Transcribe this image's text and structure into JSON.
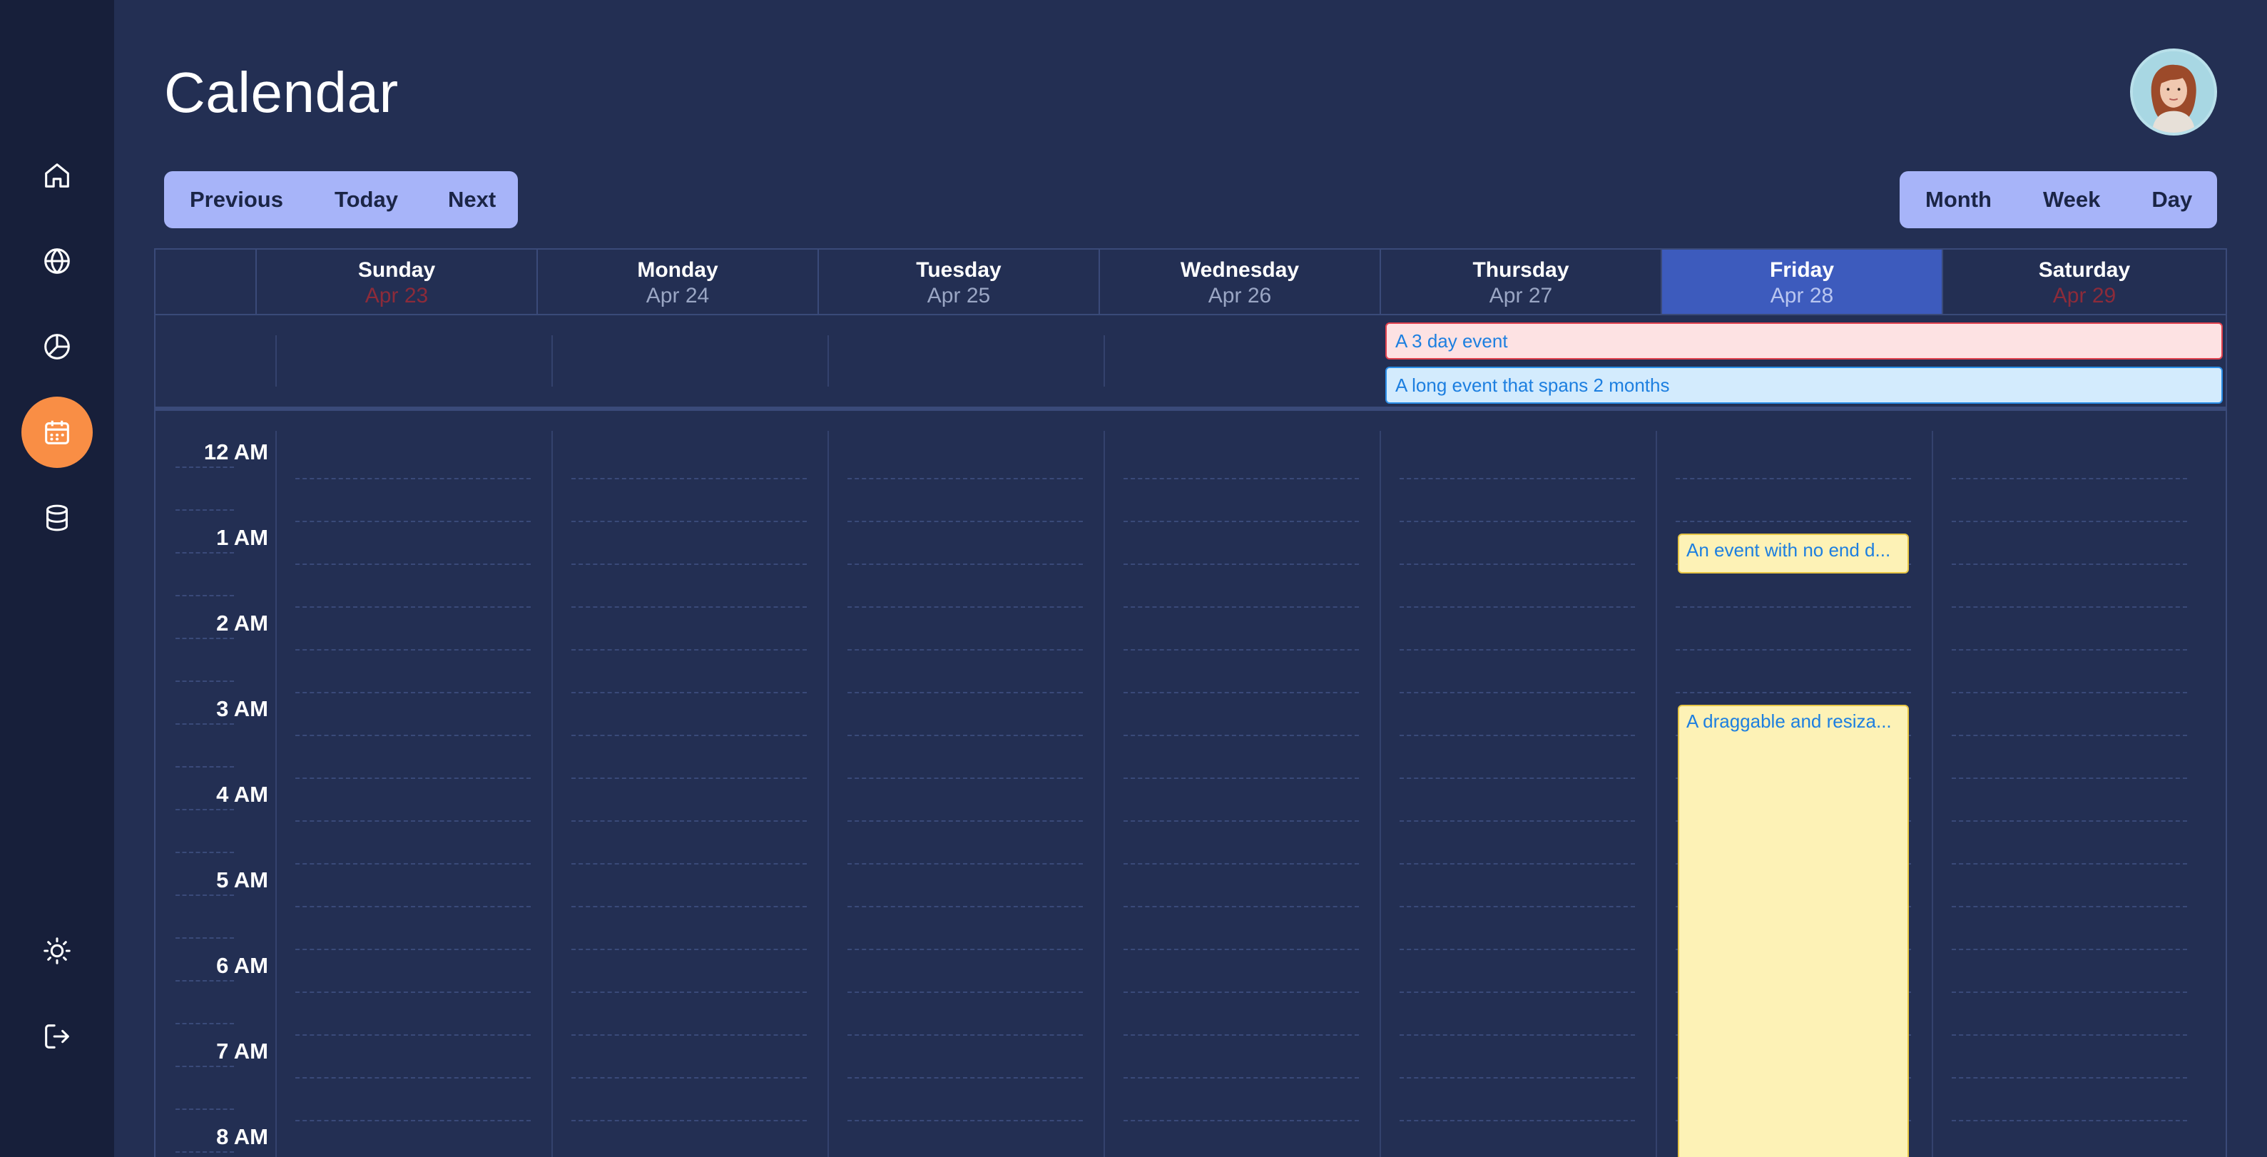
{
  "sidebar": {
    "items": [
      {
        "icon": "home-icon",
        "active": false
      },
      {
        "icon": "globe-icon",
        "active": false
      },
      {
        "icon": "pie-chart-icon",
        "active": false
      },
      {
        "icon": "calendar-icon",
        "active": true
      },
      {
        "icon": "database-icon",
        "active": false
      }
    ],
    "bottom_items": [
      {
        "icon": "sun-icon"
      },
      {
        "icon": "logout-icon"
      }
    ]
  },
  "header": {
    "title": "Calendar"
  },
  "nav_buttons": {
    "previous": "Previous",
    "today": "Today",
    "next": "Next"
  },
  "view_buttons": {
    "month": "Month",
    "week": "Week",
    "day": "Day"
  },
  "days": [
    {
      "name": "Sunday",
      "date": "Apr 23",
      "weekend": true,
      "today": false
    },
    {
      "name": "Monday",
      "date": "Apr 24",
      "weekend": false,
      "today": false
    },
    {
      "name": "Tuesday",
      "date": "Apr 25",
      "weekend": false,
      "today": false
    },
    {
      "name": "Wednesday",
      "date": "Apr 26",
      "weekend": false,
      "today": false
    },
    {
      "name": "Thursday",
      "date": "Apr 27",
      "weekend": false,
      "today": false
    },
    {
      "name": "Friday",
      "date": "Apr 28",
      "weekend": false,
      "today": true
    },
    {
      "name": "Saturday",
      "date": "Apr 29",
      "weekend": true,
      "today": false
    }
  ],
  "all_day_events": [
    {
      "title": "A 3 day event",
      "color": "red"
    },
    {
      "title": "A long event that spans 2 months",
      "color": "blue"
    }
  ],
  "hours": [
    "12 AM",
    "1 AM",
    "2 AM",
    "3 AM",
    "4 AM",
    "5 AM",
    "6 AM",
    "7 AM",
    "8 AM"
  ],
  "timed_events": [
    {
      "title": "An event with no end d...",
      "day": "Friday"
    },
    {
      "title": "A draggable and resiza...",
      "day": "Friday"
    }
  ],
  "colors": {
    "background": "#232f53",
    "sidebar": "#171f3a",
    "accent": "#f98e45",
    "button_bg": "#a7b4f9",
    "today_column": "#3d5bbd",
    "event_text": "#1d7fe0"
  }
}
